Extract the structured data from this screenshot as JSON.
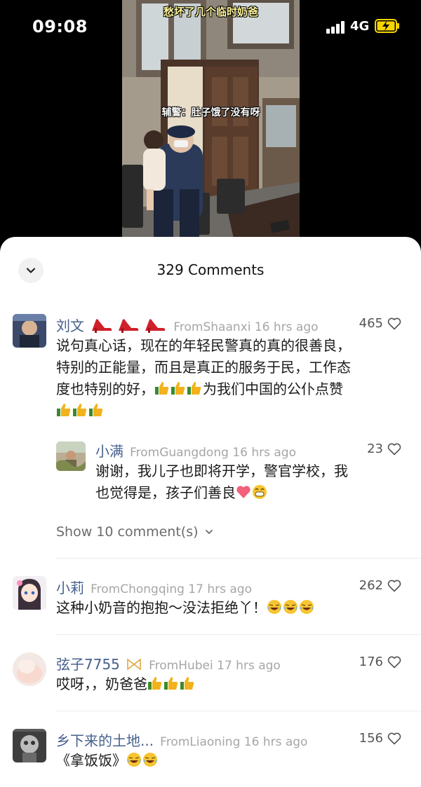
{
  "status": {
    "time": "09:08",
    "network": "4G"
  },
  "video": {
    "caption": "愁坏了几个临时奶爸",
    "subtitle": "辅警：肚子饿了没有呀"
  },
  "comments_header": {
    "title": "329 Comments"
  },
  "comments": [
    {
      "name": "刘文",
      "location": "FromShaanxi 16 hrs ago",
      "likes": "465",
      "text_line1": "说句真心话，现在的年轻民警真的真的很善良，",
      "text_line2": "特别的正能量，而且是真正的服务于民，工作态",
      "text_line3": "度也特别的好，",
      "text_line3b": "为我们中国的公仆点赞",
      "reply": {
        "name": "小满",
        "location": "FromGuangdong 16 hrs ago",
        "likes": "23",
        "text_line1": "谢谢，我儿子也即将开学，警官学校，我",
        "text_line2": "也觉得是，孩子们善良"
      },
      "show_more": "Show 10 comment(s)"
    },
    {
      "name": "小莉",
      "location": "FromChongqing 17 hrs ago",
      "likes": "262",
      "text": "这种小奶音的抱抱～没法拒绝丫！"
    },
    {
      "name": "弦子7755",
      "location": "FromHubei 17 hrs ago",
      "likes": "176",
      "text": "哎呀，，奶爸爸"
    },
    {
      "name": "乡下来的土地...",
      "location": "FromLiaoning 16 hrs ago",
      "likes": "156",
      "text": "《拿饭饭》"
    }
  ],
  "icons": {
    "high_heel": "high-heel-shoe-icon",
    "thumbs_up": "thumbs-up-icon",
    "heart": "heart-icon",
    "grin": "grinning-face-icon",
    "laugh_cry": "laugh-cry-face-icon",
    "like": "heart-outline-icon"
  },
  "colors": {
    "name": "#46608d",
    "meta": "#a6a6a6",
    "caption": "#fff59a",
    "battery": "#f5d400"
  }
}
